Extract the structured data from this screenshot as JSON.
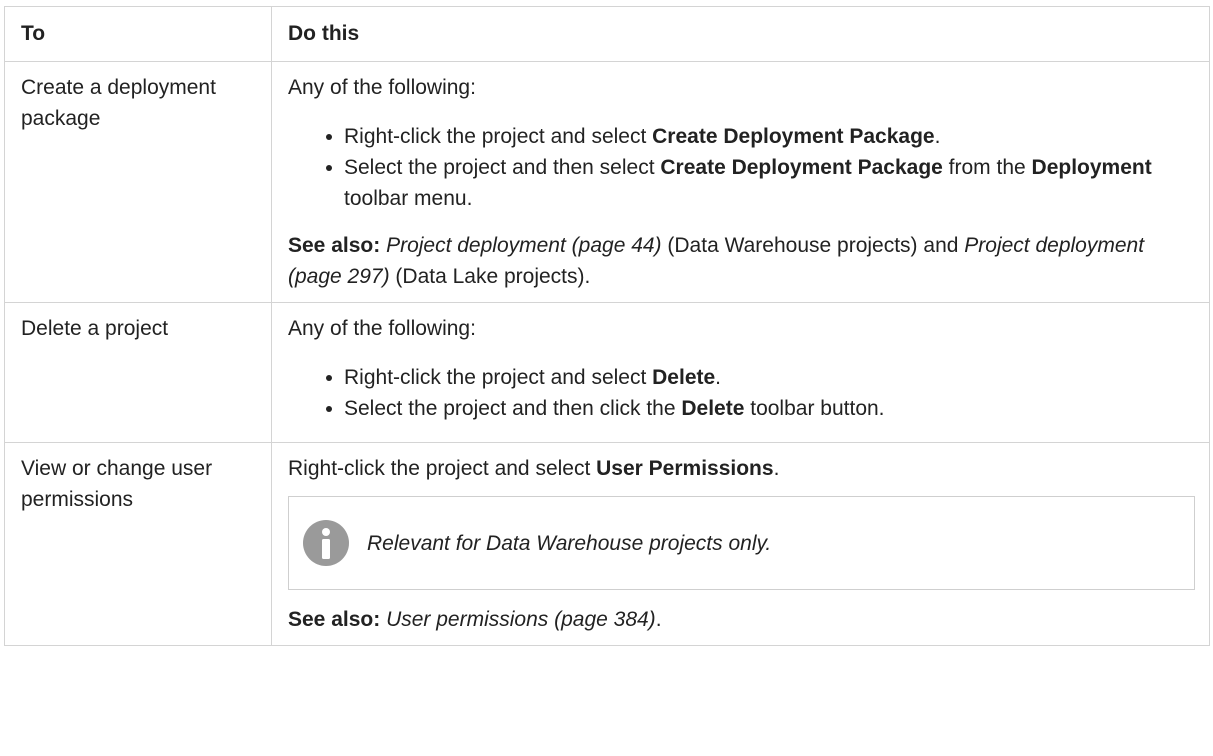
{
  "table": {
    "headers": {
      "col1": "To",
      "col2": "Do this"
    },
    "row1": {
      "task": "Create a deployment package",
      "intro": "Any of the following:",
      "bullet1": {
        "pre": "Right-click the project and select ",
        "bold": "Create Deployment Package",
        "post": "."
      },
      "bullet2": {
        "pre": "Select the project and then select ",
        "bold1": "Create Deployment Package",
        "mid": " from the ",
        "bold2": "Deployment",
        "post": " toolbar menu."
      },
      "see_also": {
        "label": "See also:",
        "link1": "Project deployment (page 44)",
        "text1": " (Data Warehouse projects) and ",
        "link2": "Project deployment (page 297)",
        "text2": " (Data Lake projects)."
      }
    },
    "row2": {
      "task": "Delete a project",
      "intro": "Any of the following:",
      "bullet1": {
        "pre": "Right-click the project and select ",
        "bold": "Delete",
        "post": "."
      },
      "bullet2": {
        "pre": "Select the project and then click the ",
        "bold": "Delete",
        "post": " toolbar button."
      }
    },
    "row3": {
      "task": "View or change user permissions",
      "line": {
        "pre": "Right-click the project and select ",
        "bold": "User Permissions",
        "post": "."
      },
      "note": {
        "icon": "info-icon",
        "text": "Relevant for Data Warehouse projects only."
      },
      "see_also": {
        "label": "See also:",
        "link": "User permissions (page 384)",
        "post": "."
      }
    }
  },
  "colors": {
    "border": "#d4d4d4",
    "text": "#222222",
    "icon": "#9a9a9a"
  }
}
